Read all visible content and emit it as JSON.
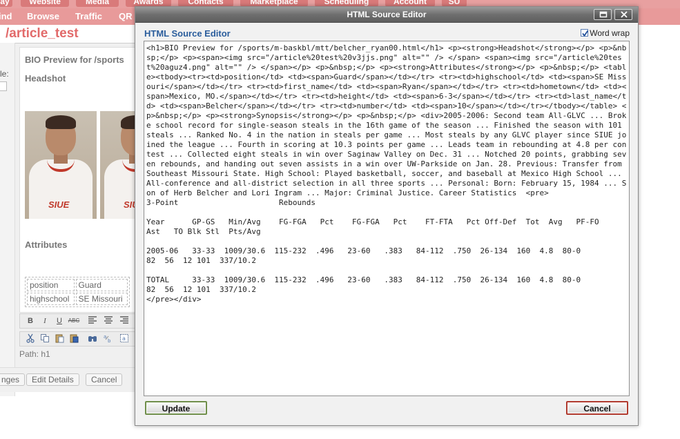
{
  "app": {
    "primary_tabs": [
      "ay",
      "Website",
      "Media",
      "Awards",
      "Contacts",
      "Marketplace",
      "Scheduling",
      "Account",
      "SU"
    ],
    "secondary_nav": [
      "ind",
      "Browse",
      "Traffic",
      "QR"
    ],
    "page_title": "/article_test",
    "left_label": "le:",
    "preview": {
      "heading": "BIO Preview for /sports",
      "headshot_label": "Headshot",
      "attributes_label": "Attributes",
      "attributes": [
        {
          "key": "position",
          "value": "Guard"
        },
        {
          "key": "highschool",
          "value": "SE Missouri"
        }
      ],
      "photo_logo": "SIUE"
    },
    "path": "Path: h1",
    "bottom_buttons": [
      "nges",
      "Edit Details",
      "Cancel"
    ],
    "toolbar_icons": {
      "row1": [
        "bold-icon",
        "italic-icon",
        "underline-icon",
        "strikethrough-icon",
        "align-left-icon",
        "align-center-icon",
        "align-right-icon"
      ],
      "row2": [
        "cut-icon",
        "copy-icon",
        "paste-icon",
        "paste-word-icon",
        "find-icon",
        "replace-icon",
        "select-all-icon"
      ]
    }
  },
  "modal": {
    "window_title": "HTML Source Editor",
    "heading": "HTML Source Editor",
    "word_wrap_label": "Word wrap",
    "word_wrap_checked": true,
    "source_code": "<h1>BIO Preview for /sports/m-baskbl/mtt/belcher_ryan00.html</h1> <p><strong>Headshot</strong></p> <p>&nbsp;</p> <p><span><img src=\"/article%20test%20v3jjs.png\" alt=\"\" /> </span> <span><img src=\"/article%20test%20aguz4.png\" alt=\"\" /> </span></p> <p>&nbsp;</p> <p><strong>Attributes</strong></p> <p>&nbsp;</p> <table><tbody><tr><td>position</td> <td><span>Guard</span></td></tr> <tr><td>highschool</td> <td><span>SE Missouri</span></td></tr> <tr><td>first_name</td> <td><span>Ryan</span></td></tr> <tr><td>hometown</td> <td><span>Mexico, MO.</span></td></tr> <tr><td>height</td> <td><span>6-3</span></td></tr> <tr><td>last_name</td> <td><span>Belcher</span></td></tr> <tr><td>number</td> <td><span>10</span></td></tr></tbody></table> <p>&nbsp;</p> <p><strong>Synopsis</strong></p> <p>&nbsp;</p> <div>2005-2006: Second team All-GLVC ... Broke school record for single-season steals in the 16th game of the season ... Finished the season with 101 steals ... Ranked No. 4 in the nation in steals per game ... Most steals by any GLVC player since SIUE joined the league ... Fourth in scoring at 10.3 points per game ... Leads team in rebounding at 4.8 per contest ... Collected eight steals in win over Saginaw Valley on Dec. 31 ... Notched 20 points, grabbing seven rebounds, and handing out seven assists in a win over UW-Parkside on Jan. 28. Previous: Transfer from Southeast Missouri State. High School: Played basketball, soccer, and baseball at Mexico High School ... All-conference and all-district selection in all three sports ... Personal: Born: February 15, 1984 ... Son of Herb Belcher and Lori Ingram ... Major: Criminal Justice. Career Statistics  <pre>",
    "pre_block": "3-Point                      Rebounds\n\nYear      GP-GS   Min/Avg    FG-FGA   Pct    FG-FGA   Pct    FT-FTA   Pct Off-Def  Tot  Avg   PF-FO\nAst   TO Blk Stl  Pts/Avg\n\n2005-06   33-33  1009/30.6  115-232  .496   23-60   .383   84-112  .750  26-134  160  4.8  80-0\n82  56  12 101  337/10.2\n\nTOTAL     33-33  1009/30.6  115-232  .496   23-60   .383   84-112  .750  26-134  160  4.8  80-0\n82  56  12 101  337/10.2\n</pre></div>",
    "update_label": "Update",
    "cancel_label": "Cancel",
    "colors": {
      "heading": "#2a5d9c",
      "update_border": "#6f8e4a",
      "cancel_border": "#b03a2e",
      "nav_pink": "#e89a9a",
      "title_pink": "#e26a6a"
    }
  }
}
